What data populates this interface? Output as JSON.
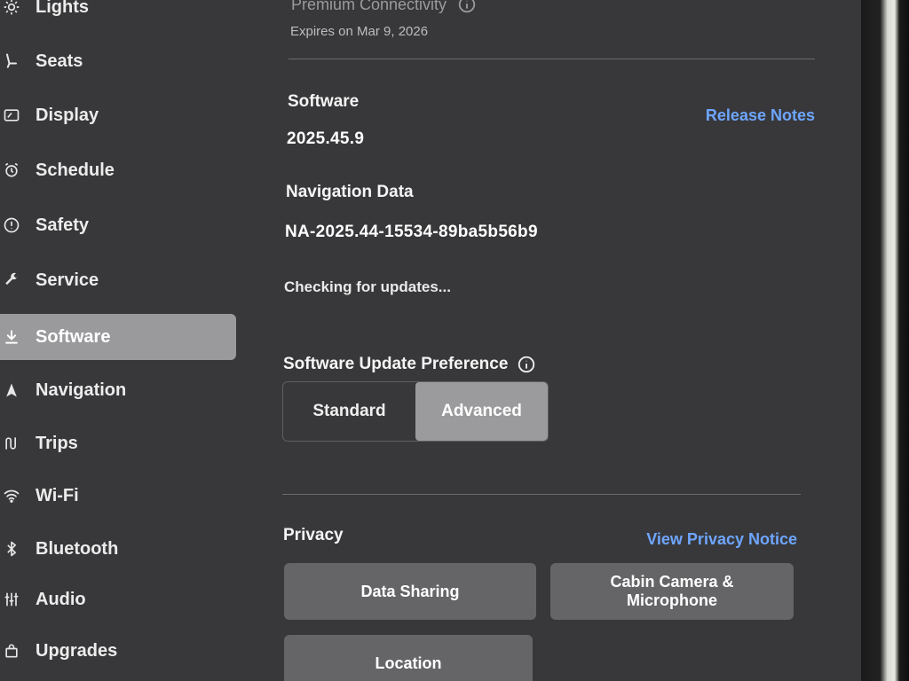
{
  "sidebar": {
    "items": [
      {
        "label": "Lights",
        "icon": "sun-icon"
      },
      {
        "label": "Seats",
        "icon": "seat-icon"
      },
      {
        "label": "Display",
        "icon": "display-icon"
      },
      {
        "label": "Schedule",
        "icon": "alarm-clock-icon"
      },
      {
        "label": "Safety",
        "icon": "alert-circle-icon"
      },
      {
        "label": "Service",
        "icon": "wrench-icon"
      },
      {
        "label": "Software",
        "icon": "download-icon",
        "active": true
      },
      {
        "label": "Navigation",
        "icon": "navigation-arrow-icon"
      },
      {
        "label": "Trips",
        "icon": "trips-icon"
      },
      {
        "label": "Wi-Fi",
        "icon": "wifi-icon"
      },
      {
        "label": "Bluetooth",
        "icon": "bluetooth-icon"
      },
      {
        "label": "Audio",
        "icon": "audio-sliders-icon"
      },
      {
        "label": "Upgrades",
        "icon": "shopping-bag-icon"
      }
    ]
  },
  "main": {
    "connectivity": {
      "title": "Premium Connectivity",
      "expires": "Expires on Mar 9, 2026"
    },
    "software": {
      "heading": "Software",
      "version": "2025.45.9",
      "release_notes": "Release Notes"
    },
    "navigation_data": {
      "heading": "Navigation Data",
      "version": "NA-2025.44-15534-89ba5b56b9"
    },
    "status": "Checking for updates...",
    "update_preference": {
      "heading": "Software Update Preference",
      "options": [
        "Standard",
        "Advanced"
      ],
      "selected": "Advanced"
    },
    "privacy": {
      "heading": "Privacy",
      "link": "View Privacy Notice",
      "tiles": [
        "Data Sharing",
        "Cabin Camera &\nMicrophone",
        "Location"
      ]
    }
  },
  "colors": {
    "background": "#38383a",
    "active_item": "#9a9a9c",
    "link": "#6ea6ff",
    "tile": "#656567"
  }
}
